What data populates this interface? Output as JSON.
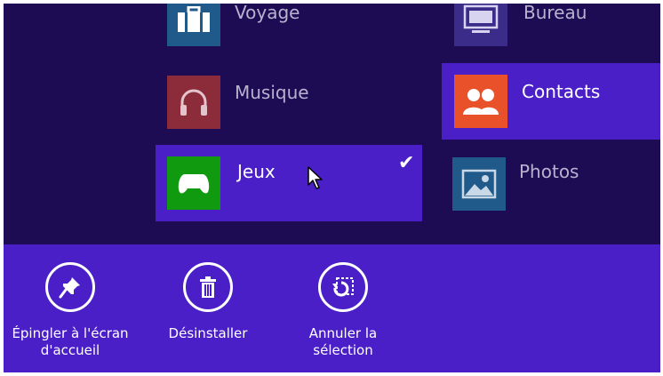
{
  "tiles": {
    "voyage": {
      "label": "Voyage",
      "icon": "suitcase-icon",
      "color": "#1f5a8a"
    },
    "bureau": {
      "label": "Bureau",
      "icon": "desktop-icon",
      "color": "#3b2c8a"
    },
    "musique": {
      "label": "Musique",
      "icon": "headphones-icon",
      "color": "#8c2b3a"
    },
    "contacts": {
      "label": "Contacts",
      "icon": "people-icon",
      "color": "#e9512a"
    },
    "jeux": {
      "label": "Jeux",
      "icon": "gamepad-icon",
      "color": "#109a10",
      "selected": true,
      "check": "✔"
    },
    "photos": {
      "label": "Photos",
      "icon": "photo-icon",
      "color": "#1f5a8a"
    }
  },
  "appbar": {
    "pin": {
      "label_line1": "Épingler à l'écran",
      "label_line2": "d'accueil",
      "icon": "pin-icon"
    },
    "uninstall": {
      "label": "Désinstaller",
      "icon": "trash-icon"
    },
    "clear": {
      "label_line1": "Annuler la",
      "label_line2": "sélection",
      "icon": "clear-selection-icon"
    }
  },
  "colors": {
    "background": "#1d0b53",
    "accent": "#4b1fc8"
  }
}
